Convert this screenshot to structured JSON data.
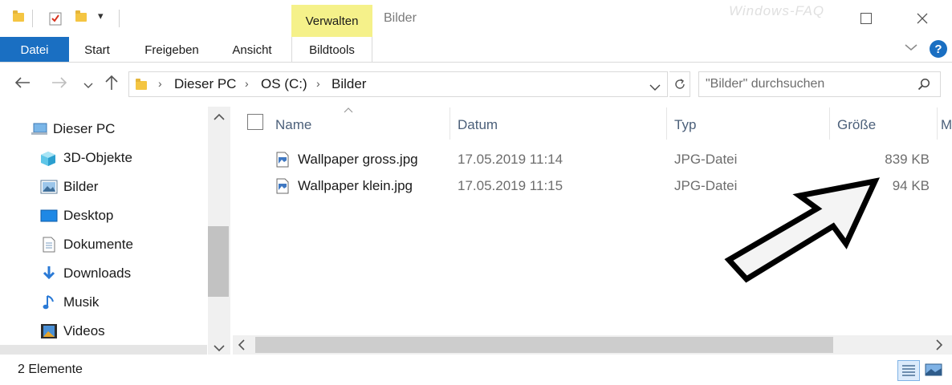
{
  "window": {
    "title": "Bilder",
    "context_tab": "Verwalten",
    "watermark": "Windows-FAQ"
  },
  "ribbon": {
    "tabs": [
      {
        "label": "Datei",
        "active": true
      },
      {
        "label": "Start"
      },
      {
        "label": "Freigeben"
      },
      {
        "label": "Ansicht"
      },
      {
        "label": "Bildtools"
      }
    ]
  },
  "address": {
    "breadcrumbs": [
      "Dieser PC",
      "OS (C:)",
      "Bilder"
    ]
  },
  "search": {
    "placeholder": "\"Bilder\" durchsuchen"
  },
  "nav": {
    "items": [
      {
        "label": "Dieser PC",
        "icon": "pc-icon"
      },
      {
        "label": "3D-Objekte",
        "icon": "cube-icon"
      },
      {
        "label": "Bilder",
        "icon": "pictures-icon"
      },
      {
        "label": "Desktop",
        "icon": "desktop-icon"
      },
      {
        "label": "Dokumente",
        "icon": "documents-icon"
      },
      {
        "label": "Downloads",
        "icon": "download-icon"
      },
      {
        "label": "Musik",
        "icon": "music-icon"
      },
      {
        "label": "Videos",
        "icon": "videos-icon"
      }
    ]
  },
  "columns": {
    "name": "Name",
    "date": "Datum",
    "type": "Typ",
    "size": "Größe"
  },
  "files": [
    {
      "name": "Wallpaper gross.jpg",
      "date": "17.05.2019 11:14",
      "type": "JPG-Datei",
      "size": "839 KB"
    },
    {
      "name": "Wallpaper klein.jpg",
      "date": "17.05.2019 11:15",
      "type": "JPG-Datei",
      "size": "94 KB"
    }
  ],
  "status": {
    "count": "2 Elemente"
  },
  "colors": {
    "accent": "#1a6fc2",
    "context_tab": "#f5f18a",
    "header_text": "#4c607a"
  }
}
